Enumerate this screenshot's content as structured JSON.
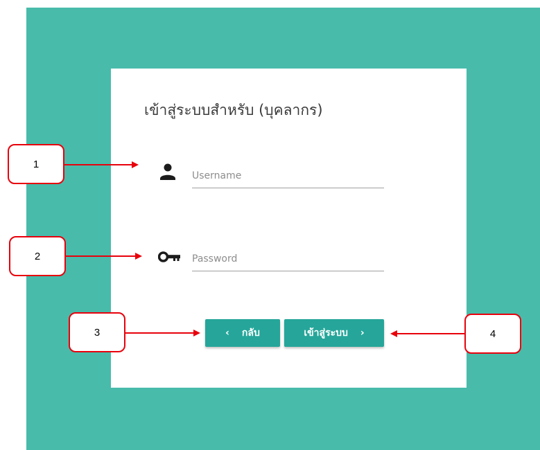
{
  "login": {
    "title": "เข้าสู่ระบบสำหรับ (บุคลากร)",
    "username": {
      "placeholder": "Username",
      "value": ""
    },
    "password": {
      "placeholder": "Password",
      "value": ""
    },
    "back_button": {
      "label": "กลับ",
      "chevron": "‹"
    },
    "login_button": {
      "label": "เข้าสู่ระบบ",
      "chevron": "›"
    }
  },
  "callouts": [
    {
      "label": "1"
    },
    {
      "label": "2"
    },
    {
      "label": "3"
    },
    {
      "label": "4"
    }
  ],
  "colors": {
    "background": "#48bbab",
    "button": "#26a69a",
    "callout_border": "#e8000b"
  },
  "icons": {
    "username": "person-icon",
    "password": "key-icon"
  }
}
